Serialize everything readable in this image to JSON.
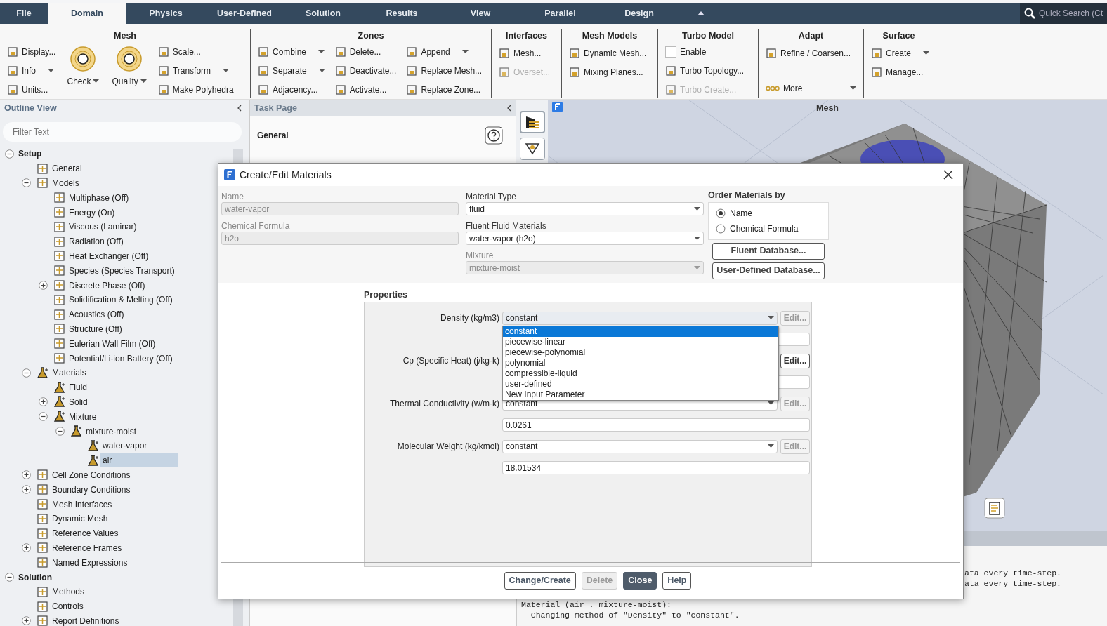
{
  "menu_tabs": [
    {
      "label": "File",
      "selected": false
    },
    {
      "label": "Domain",
      "selected": true
    },
    {
      "label": "Physics",
      "selected": false
    },
    {
      "label": "User-Defined",
      "selected": false
    },
    {
      "label": "Solution",
      "selected": false
    },
    {
      "label": "Results",
      "selected": false
    },
    {
      "label": "View",
      "selected": false
    },
    {
      "label": "Parallel",
      "selected": false
    },
    {
      "label": "Design",
      "selected": false
    }
  ],
  "quick_search": {
    "placeholder": "Quick Search (Ct"
  },
  "ribbon": [
    {
      "title": "Mesh",
      "columns": [
        [
          {
            "kind": "small",
            "label": "Display...",
            "dropdown": false,
            "disabled": false
          },
          {
            "kind": "small",
            "label": "Info",
            "dropdown": true,
            "disabled": false
          },
          {
            "kind": "small",
            "label": "Units...",
            "dropdown": false,
            "disabled": false
          }
        ],
        [
          {
            "kind": "big",
            "label": "Check",
            "dropdown": true,
            "disabled": false
          }
        ],
        [
          {
            "kind": "big",
            "label": "Quality",
            "dropdown": true,
            "disabled": false
          }
        ],
        [
          {
            "kind": "small",
            "label": "Scale...",
            "dropdown": false,
            "disabled": false
          },
          {
            "kind": "small",
            "label": "Transform",
            "dropdown": true,
            "disabled": false
          },
          {
            "kind": "small",
            "label": "Make Polyhedra",
            "dropdown": false,
            "disabled": false
          }
        ]
      ]
    },
    {
      "title": "Zones",
      "columns": [
        [
          {
            "kind": "small",
            "label": "Combine",
            "dropdown": true,
            "disabled": false
          },
          {
            "kind": "small",
            "label": "Separate",
            "dropdown": true,
            "disabled": false
          },
          {
            "kind": "small",
            "label": "Adjacency...",
            "dropdown": false,
            "disabled": false
          }
        ],
        [
          {
            "kind": "small",
            "label": "Delete...",
            "dropdown": false,
            "disabled": false
          },
          {
            "kind": "small",
            "label": "Deactivate...",
            "dropdown": false,
            "disabled": false
          },
          {
            "kind": "small",
            "label": "Activate...",
            "dropdown": false,
            "disabled": false
          }
        ],
        [
          {
            "kind": "small",
            "label": "Append",
            "dropdown": true,
            "disabled": false
          },
          {
            "kind": "small",
            "label": "Replace Mesh...",
            "dropdown": false,
            "disabled": false
          },
          {
            "kind": "small",
            "label": "Replace Zone...",
            "dropdown": false,
            "disabled": false
          }
        ]
      ]
    },
    {
      "title": "Interfaces",
      "columns": [
        [
          {
            "kind": "small",
            "label": "Mesh...",
            "dropdown": false,
            "disabled": false
          },
          {
            "kind": "small",
            "label": "Overset...",
            "dropdown": false,
            "disabled": true
          }
        ]
      ]
    },
    {
      "title": "Mesh Models",
      "columns": [
        [
          {
            "kind": "small",
            "label": "Dynamic Mesh...",
            "dropdown": false,
            "disabled": false
          },
          {
            "kind": "small",
            "label": "Mixing Planes...",
            "dropdown": false,
            "disabled": false
          }
        ]
      ]
    },
    {
      "title": "Turbo Model",
      "columns": [
        [
          {
            "kind": "checkbox",
            "label": "Enable",
            "checked": false,
            "disabled": false
          },
          {
            "kind": "small",
            "label": "Turbo Topology...",
            "dropdown": false,
            "disabled": false
          },
          {
            "kind": "small",
            "label": "Turbo Create...",
            "dropdown": false,
            "disabled": true
          }
        ]
      ]
    },
    {
      "title": "Adapt",
      "columns": [
        [
          {
            "kind": "small",
            "label": "Refine / Coarsen...",
            "dropdown": false,
            "disabled": false
          }
        ]
      ],
      "more": {
        "label": "More"
      }
    },
    {
      "title": "Surface",
      "columns": [
        [
          {
            "kind": "small",
            "label": "Create",
            "dropdown": true,
            "disabled": false
          },
          {
            "kind": "small",
            "label": "Manage...",
            "dropdown": false,
            "disabled": false
          }
        ]
      ]
    }
  ],
  "outline_view": {
    "title": "Outline View",
    "filter": {
      "placeholder": "Filter Text"
    },
    "tree": [
      {
        "label": "Setup",
        "kind": "section",
        "expanded": true,
        "selected": false,
        "children": [
          {
            "label": "General",
            "kind": "item",
            "selected": false
          },
          {
            "label": "Models",
            "kind": "item",
            "expanded": true,
            "selected": false,
            "children": [
              {
                "label": "Multiphase (Off)",
                "kind": "item",
                "selected": false
              },
              {
                "label": "Energy (On)",
                "kind": "item",
                "selected": false
              },
              {
                "label": "Viscous (Laminar)",
                "kind": "item",
                "selected": false
              },
              {
                "label": "Radiation (Off)",
                "kind": "item",
                "selected": false
              },
              {
                "label": "Heat Exchanger (Off)",
                "kind": "item",
                "selected": false
              },
              {
                "label": "Species (Species Transport)",
                "kind": "item",
                "selected": false
              },
              {
                "label": "Discrete Phase (Off)",
                "kind": "item",
                "expanded": false,
                "selected": false
              },
              {
                "label": "Solidification & Melting (Off)",
                "kind": "item",
                "selected": false
              },
              {
                "label": "Acoustics (Off)",
                "kind": "item",
                "selected": false
              },
              {
                "label": "Structure (Off)",
                "kind": "item",
                "selected": false
              },
              {
                "label": "Eulerian Wall Film (Off)",
                "kind": "item",
                "selected": false
              },
              {
                "label": "Potential/Li-ion Battery (Off)",
                "kind": "item",
                "selected": false
              }
            ]
          },
          {
            "label": "Materials",
            "kind": "material",
            "expanded": true,
            "selected": false,
            "children": [
              {
                "label": "Fluid",
                "kind": "material",
                "selected": false
              },
              {
                "label": "Solid",
                "kind": "material",
                "expanded": false,
                "selected": false
              },
              {
                "label": "Mixture",
                "kind": "material",
                "expanded": true,
                "selected": false,
                "children": [
                  {
                    "label": "mixture-moist",
                    "kind": "material",
                    "expanded": true,
                    "selected": false,
                    "children": [
                      {
                        "label": "water-vapor",
                        "kind": "material",
                        "selected": false
                      },
                      {
                        "label": "air",
                        "kind": "material",
                        "selected": true
                      }
                    ]
                  }
                ]
              }
            ]
          },
          {
            "label": "Cell Zone Conditions",
            "kind": "item",
            "expanded": false,
            "selected": false
          },
          {
            "label": "Boundary Conditions",
            "kind": "item",
            "expanded": false,
            "selected": false
          },
          {
            "label": "Mesh Interfaces",
            "kind": "item",
            "selected": false
          },
          {
            "label": "Dynamic Mesh",
            "kind": "item",
            "selected": false
          },
          {
            "label": "Reference Values",
            "kind": "item",
            "selected": false
          },
          {
            "label": "Reference Frames",
            "kind": "item",
            "expanded": false,
            "selected": false
          },
          {
            "label": "Named Expressions",
            "kind": "item",
            "selected": false
          }
        ]
      },
      {
        "label": "Solution",
        "kind": "section",
        "expanded": true,
        "selected": false,
        "children": [
          {
            "label": "Methods",
            "kind": "item",
            "selected": false
          },
          {
            "label": "Controls",
            "kind": "item",
            "selected": false
          },
          {
            "label": "Report Definitions",
            "kind": "item",
            "expanded": false,
            "selected": false
          }
        ]
      }
    ]
  },
  "task_page": {
    "title": "Task Page",
    "heading": "General"
  },
  "graphics": {
    "title": "Mesh"
  },
  "console": {
    "lines": [
      "ata every time-step.",
      "ata every time-step."
    ],
    "lines_after": [
      "Material (air . mixture-moist):",
      "  Changing method of \"Density\" to \"constant\"."
    ]
  },
  "dialog": {
    "title": "Create/Edit Materials",
    "name": {
      "label": "Name",
      "value": "water-vapor",
      "disabled": true
    },
    "chemical_formula": {
      "label": "Chemical Formula",
      "value": "h2o",
      "disabled": true
    },
    "material_type": {
      "label": "Material Type",
      "value": "fluid",
      "disabled": false
    },
    "fluent_materials": {
      "label": "Fluent Fluid Materials",
      "value": "water-vapor (h2o)",
      "disabled": false
    },
    "mixture": {
      "label": "Mixture",
      "value": "mixture-moist",
      "disabled": true
    },
    "order_by": {
      "label": "Order Materials by",
      "options": [
        {
          "label": "Name",
          "selected": true
        },
        {
          "label": "Chemical Formula",
          "selected": false
        }
      ]
    },
    "database_buttons": [
      "Fluent Database...",
      "User-Defined Database..."
    ],
    "properties_label": "Properties",
    "properties": [
      {
        "label": "Density (kg/m3)",
        "method": "constant",
        "edit_label": "Edit...",
        "edit_disabled": true
      },
      {
        "label": "Cp (Specific Heat) (j/kg-k)",
        "edit_label": "Edit...",
        "edit_disabled": false
      },
      {
        "label": "Thermal Conductivity (w/m-k)",
        "method": "constant",
        "edit_label": "Edit...",
        "edit_disabled": true,
        "value": "0.0261"
      },
      {
        "label": "Molecular Weight (kg/kmol)",
        "method": "constant",
        "edit_label": "Edit...",
        "edit_disabled": true,
        "value": "18.01534"
      }
    ],
    "method_options": [
      {
        "label": "constant",
        "selected": true
      },
      {
        "label": "piecewise-linear",
        "selected": false
      },
      {
        "label": "piecewise-polynomial",
        "selected": false
      },
      {
        "label": "polynomial",
        "selected": false
      },
      {
        "label": "compressible-liquid",
        "selected": false
      },
      {
        "label": "user-defined",
        "selected": false
      },
      {
        "label": "New Input Parameter",
        "selected": false
      }
    ],
    "buttons": [
      {
        "label": "Change/Create",
        "disabled": false,
        "default": false
      },
      {
        "label": "Delete",
        "disabled": true,
        "default": false
      },
      {
        "label": "Close",
        "disabled": false,
        "default": true
      },
      {
        "label": "Help",
        "disabled": false,
        "default": false
      }
    ]
  }
}
